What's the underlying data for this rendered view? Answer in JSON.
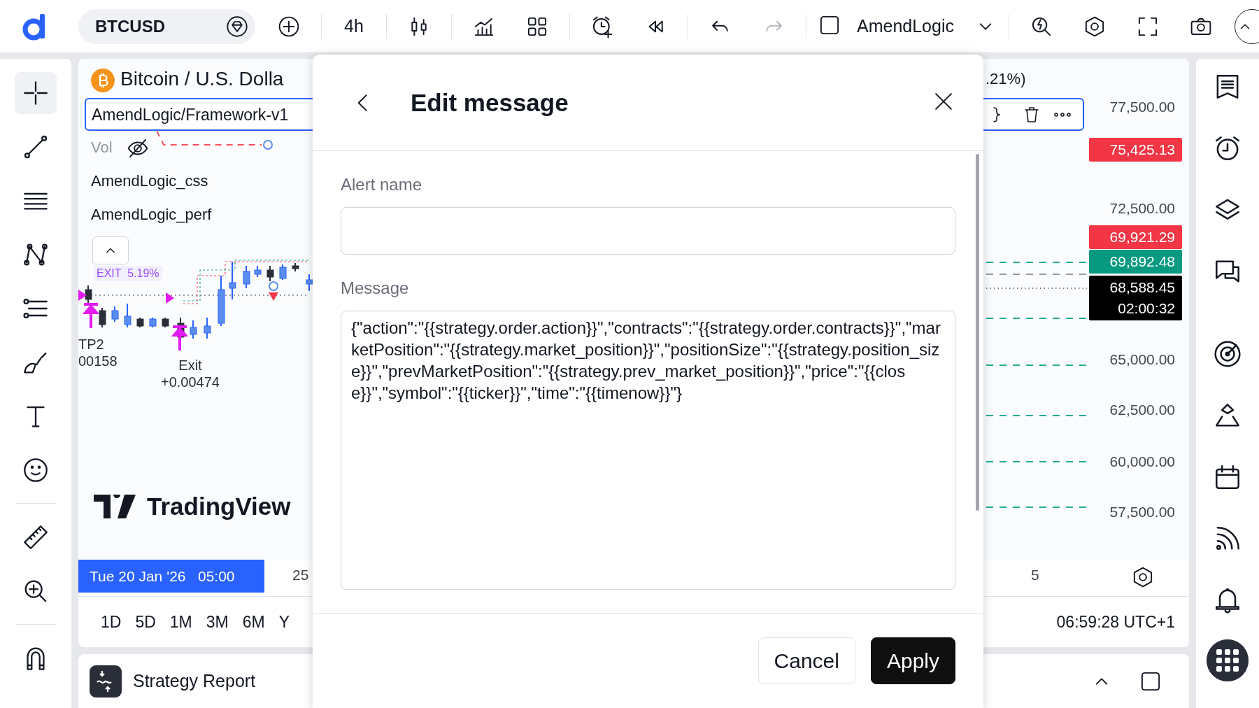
{
  "top_bar": {
    "symbol": "BTCUSD",
    "interval": "4h",
    "layout": "AmendLogic",
    "undo": {
      "disabled": false
    },
    "redo": {
      "disabled": true
    }
  },
  "drawing_tools": [
    {
      "kind": "crosshair",
      "selected": true
    },
    {
      "kind": "trendline",
      "selected": false
    },
    {
      "kind": "hlines",
      "selected": false
    },
    {
      "kind": "pattern",
      "selected": false
    },
    {
      "kind": "fib",
      "selected": false
    },
    {
      "kind": "brush",
      "selected": false
    },
    {
      "kind": "text",
      "selected": false
    },
    {
      "kind": "emoji",
      "selected": false
    },
    {
      "kind": "ruler",
      "selected": false
    },
    {
      "kind": "zoom",
      "selected": false
    },
    {
      "kind": "magnet",
      "selected": false
    }
  ],
  "chart": {
    "title": "Bitcoin / U.S. Dolla",
    "change": ".21%)",
    "indicator": "AmendLogic/Framework-v1",
    "volume_label": "Vol",
    "studies": [
      "AmendLogic_css",
      "AmendLogic_perf"
    ],
    "exit_label": "EXIT  5.19%",
    "trade_labels": [
      {
        "lines": [
          "TP2",
          "00158"
        ]
      },
      {
        "lines": [
          "Exit",
          "+0.00474"
        ]
      }
    ],
    "watermark": "TradingView",
    "price_axis": [
      {
        "kind": "tick",
        "label": "77,500.00"
      },
      {
        "kind": "tag",
        "label": "75,425.13",
        "color": "#f23645"
      },
      {
        "kind": "tick",
        "label": "72,500.00"
      },
      {
        "kind": "tag",
        "label": "69,921.29",
        "color": "#f23645"
      },
      {
        "kind": "tag",
        "label": "69,892.48",
        "color": "#089981"
      },
      {
        "kind": "tag",
        "label": "68,588.45",
        "countdown": "02:00:32",
        "color": "#000000"
      },
      {
        "kind": "tick",
        "label": "65,000.00"
      },
      {
        "kind": "tick",
        "label": "62,500.00"
      },
      {
        "kind": "tick",
        "label": "60,000.00"
      },
      {
        "kind": "tick",
        "label": "57,500.00"
      }
    ],
    "time_axis": [
      {
        "kind": "cursor",
        "label": "Tue 20 Jan '26   05:00"
      },
      {
        "kind": "tick",
        "label": "25"
      },
      {
        "kind": "tick",
        "label": "5"
      }
    ],
    "ranges": [
      "1D",
      "5D",
      "1M",
      "3M",
      "6M",
      "Y"
    ],
    "clock": "06:59:28 UTC+1"
  },
  "bottom_panel": {
    "title": "Strategy Report"
  },
  "dialog": {
    "title": "Edit message",
    "alert_name": {
      "label": "Alert name"
    },
    "message": {
      "label": "Message",
      "value": "{\"action\":\"{{strategy.order.action}}\",\"contracts\":\"{{strategy.order.contracts}}\",\"marketPosition\":\"{{strategy.market_position}}\",\"positionSize\":\"{{strategy.position_size}}\",\"prevMarketPosition\":\"{{strategy.prev_market_position}}\",\"price\":\"{{close}}\",\"symbol\":\"{{ticker}}\",\"time\":\"{{timenow}}\"}"
    },
    "buttons": [
      {
        "kind": "secondary",
        "label": "Cancel"
      },
      {
        "kind": "primary",
        "label": "Apply"
      }
    ]
  }
}
